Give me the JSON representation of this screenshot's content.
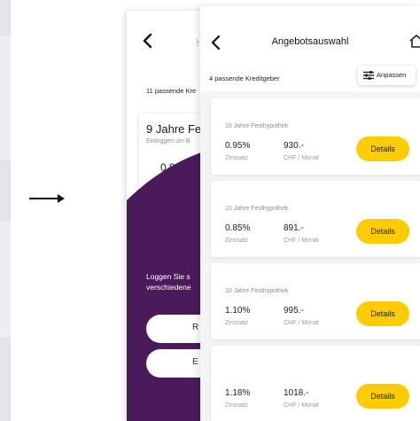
{
  "back_screen": {
    "header_fragment": "H",
    "lender_count": "11 passende Kre",
    "card": {
      "title": "9 Jahre Fe",
      "subtitle": "Einloggen um B",
      "rate_fragment": "0.9"
    },
    "promo": {
      "line1": "Loggen Sie s",
      "line2": "verschiedene"
    },
    "buttons": [
      {
        "label": "R"
      },
      {
        "label": "E"
      }
    ],
    "accent_color": "#4b1a5b"
  },
  "front_screen": {
    "title": "Angebotsauswahl",
    "lender_count": "4 passende Kreditgeber",
    "adjust_label": "Anpassen",
    "details_color": "#ffcc00",
    "offers": [
      {
        "product": "10 Jahre Festhypothek",
        "rate": "0.95%",
        "rate_label": "Zinssatz",
        "amount": "930.-",
        "amount_label": "CHF / Monat",
        "button": "Details"
      },
      {
        "product": "10 Jahre Festhypothek",
        "rate": "0.85%",
        "rate_label": "Zinssatz",
        "amount": "891.-",
        "amount_label": "CHF / Monat",
        "button": "Details"
      },
      {
        "product": "10 Jahre Festhypothek",
        "rate": "1.10%",
        "rate_label": "Zinssatz",
        "amount": "995.-",
        "amount_label": "CHF / Monat",
        "button": "Details"
      },
      {
        "product": "",
        "rate": "1.18%",
        "rate_label": "Zinssatz",
        "amount": "1018.-",
        "amount_label": "CHF / Monat",
        "button": "Details"
      }
    ]
  },
  "icons": [
    "back-chevron-icon",
    "home-icon",
    "sliders-icon",
    "right-arrow-icon"
  ]
}
